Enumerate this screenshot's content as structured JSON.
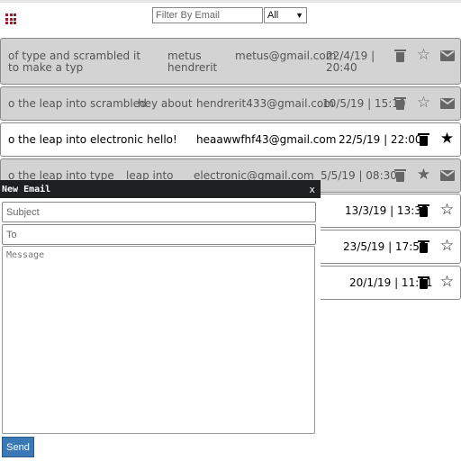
{
  "filter": {
    "placeholder": "Filter By Email",
    "selected": "All"
  },
  "emails": [
    {
      "snippet": "of type and scrambled it to make a typ",
      "subject": "metus hendrerit",
      "email": "metus@gmail.com",
      "datetime": "22/4/19 | 20:40",
      "read": true,
      "starred": false
    },
    {
      "snippet": "o the leap into scrambled",
      "subject": "hey about",
      "email": "hendrerit433@gmail.com",
      "datetime": "10/5/19 | 15:10",
      "read": true,
      "starred": false
    },
    {
      "snippet": "o the leap into electronic",
      "subject": "hello!",
      "email": "heaawwfhf43@gmail.com",
      "datetime": "22/5/19 | 22:00",
      "read": false,
      "starred": true
    },
    {
      "snippet": "o the leap into type",
      "subject": "leap into",
      "email": "electronic@gmail.com",
      "datetime": "5/5/19 | 08:30",
      "read": true,
      "starred": true
    },
    {
      "datetime": "13/3/19 | 13:35",
      "read": false,
      "starred": false
    },
    {
      "datetime": "23/5/19 | 17:55",
      "read": false,
      "starred": false
    },
    {
      "datetime": "20/1/19 | 11:11",
      "read": false,
      "starred": false
    }
  ],
  "compose": {
    "title": "New Email",
    "close_label": "x",
    "subject_placeholder": "Subject",
    "to_placeholder": "To",
    "message_placeholder": "Message",
    "send_label": "Send"
  },
  "icons": [
    "grid-icon",
    "trash-icon",
    "star-icon",
    "mail-icon",
    "chevron-down-icon"
  ],
  "colors": {
    "grid_icon": "#a3152c",
    "read_row": "#d3d3d3",
    "compose_bar": "#1d1f20",
    "send_button": "#3a79b6"
  }
}
